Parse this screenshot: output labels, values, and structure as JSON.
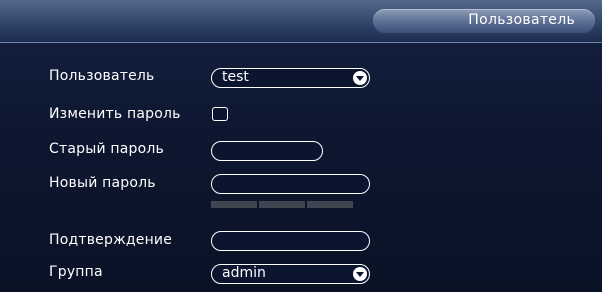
{
  "header": {
    "title": "Пользователь"
  },
  "form": {
    "user_label": "Пользователь",
    "user_value": "test",
    "change_password_label": "Изменить пароль",
    "change_password_checked": false,
    "old_password_label": "Старый пароль",
    "old_password_value": "",
    "new_password_label": "Новый пароль",
    "new_password_value": "",
    "password_strength_segments": 3,
    "confirm_label": "Подтверждение",
    "confirm_value": "",
    "group_label": "Группа",
    "group_value": "admin"
  },
  "icons": {
    "dropdown": "chevron-down-icon"
  },
  "colors": {
    "background": "#0d1730",
    "header": "#34476d",
    "text": "#ffffff",
    "strength_bar": "#3f4650"
  }
}
